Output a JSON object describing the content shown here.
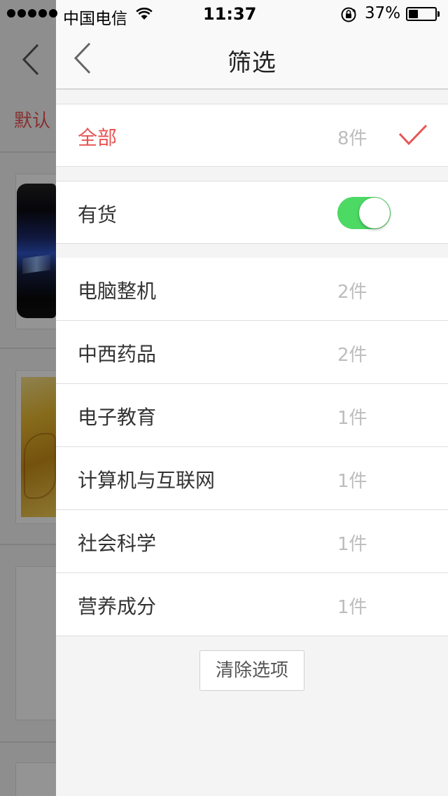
{
  "status_bar": {
    "carrier": "中国电信",
    "time": "11:37",
    "battery_percent": "37%",
    "battery_level": 0.37
  },
  "background_page": {
    "sort_tab_label": "默认"
  },
  "filter": {
    "title": "筛选",
    "all": {
      "label": "全部",
      "count": "8件",
      "selected": true
    },
    "in_stock": {
      "label": "有货",
      "enabled": true
    },
    "categories": [
      {
        "label": "电脑整机",
        "count": "2件"
      },
      {
        "label": "中西药品",
        "count": "2件"
      },
      {
        "label": "电子教育",
        "count": "1件"
      },
      {
        "label": "计算机与互联网",
        "count": "1件"
      },
      {
        "label": "社会科学",
        "count": "1件"
      },
      {
        "label": "营养成分",
        "count": "1件"
      }
    ],
    "clear_label": "清除选项"
  },
  "colors": {
    "accent": "#e85454",
    "toggle_on": "#4cd964",
    "count_text": "#bdbdbd"
  }
}
